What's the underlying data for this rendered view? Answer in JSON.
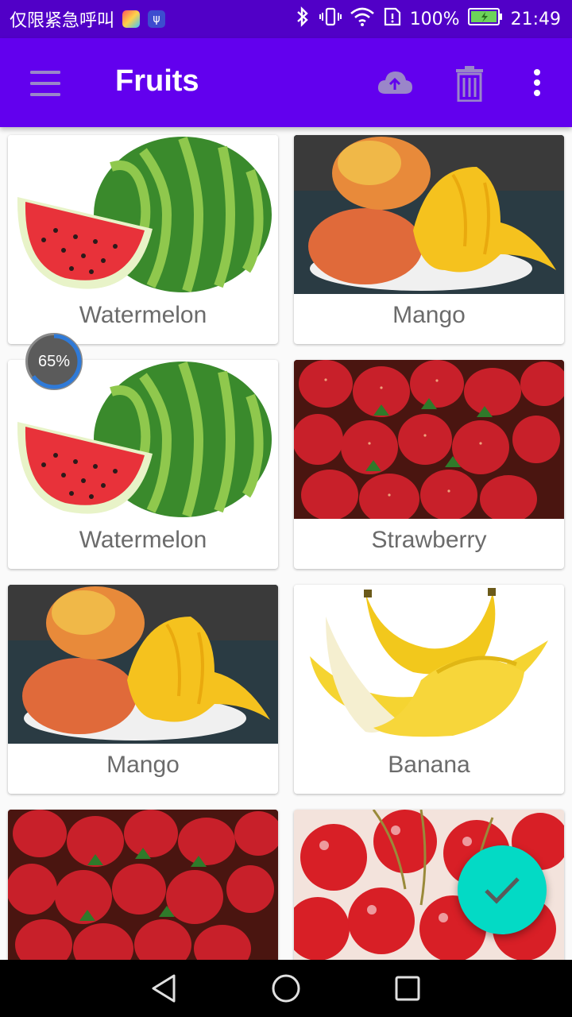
{
  "status_bar": {
    "carrier": "仅限紧急呼叫",
    "battery_percent": "100%",
    "time": "21:49"
  },
  "toolbar": {
    "title": "Fruits",
    "icons": [
      "menu-icon",
      "cloud-upload-icon",
      "delete-icon",
      "more-vert-icon"
    ]
  },
  "fruits": [
    {
      "label": "Watermelon",
      "image": "watermelon"
    },
    {
      "label": "Mango",
      "image": "mango"
    },
    {
      "label": "Watermelon",
      "image": "watermelon"
    },
    {
      "label": "Strawberry",
      "image": "strawberry"
    },
    {
      "label": "Mango",
      "image": "mango"
    },
    {
      "label": "Banana",
      "image": "banana"
    },
    {
      "label": "",
      "image": "strawberry"
    },
    {
      "label": "",
      "image": "cherry"
    }
  ],
  "progress": {
    "label": "65%",
    "value": 0.65
  },
  "fab": {
    "icon": "check-icon"
  },
  "colors": {
    "status_bar": "#5100c7",
    "toolbar": "#6200ee",
    "fab": "#03dac5"
  }
}
